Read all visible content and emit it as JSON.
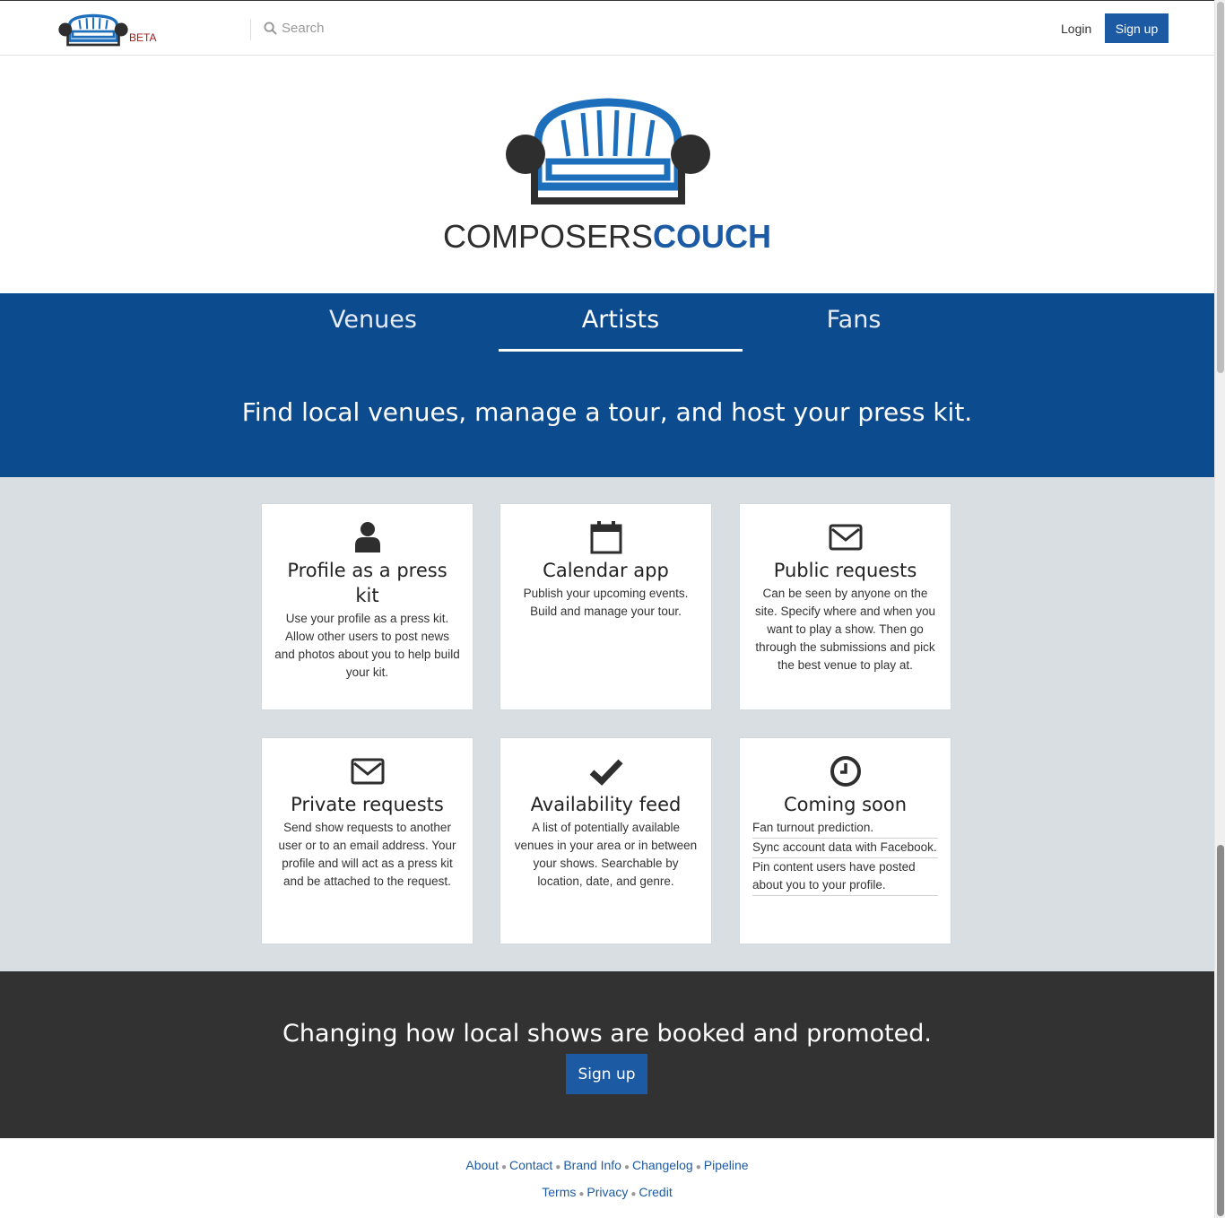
{
  "header": {
    "beta_label": "BETA",
    "search_placeholder": "Search",
    "login_label": "Login",
    "signup_label": "Sign up"
  },
  "brand": {
    "light": "COMPOSERS",
    "bold": "COUCH"
  },
  "tabs": [
    {
      "label": "Venues"
    },
    {
      "label": "Artists",
      "active": true
    },
    {
      "label": "Fans"
    }
  ],
  "tagline": "Find local venues, manage a tour, and host your press kit.",
  "features": [
    {
      "icon": "user-icon",
      "title": "Profile as a press kit",
      "text": "Use your profile as a press kit. Allow other users to post news and photos about you to help build your kit."
    },
    {
      "icon": "calendar-icon",
      "title": "Calendar app",
      "text": "Publish your upcoming events. Build and manage your tour."
    },
    {
      "icon": "envelope-icon",
      "title": "Public requests",
      "text": "Can be seen by anyone on the site. Specify where and when you want to play a show. Then go through the submissions and pick the best venue to play at."
    },
    {
      "icon": "envelope-icon",
      "title": "Private requests",
      "text": "Send show requests to another user or to an email address. Your profile and will act as a press kit and be attached to the request."
    },
    {
      "icon": "checkmark-icon",
      "title": "Availability feed",
      "text": "A list of potentially available venues in your area or in between your shows. Searchable by location, date, and genre."
    },
    {
      "icon": "clock-icon",
      "title": "Coming soon",
      "items": [
        "Fan turnout prediction.",
        "Sync account data with Facebook.",
        "Pin content users have posted about you to your profile."
      ]
    }
  ],
  "cta": {
    "heading": "Changing how local shows are booked and promoted.",
    "button_label": "Sign up"
  },
  "footer": {
    "row1": [
      "About",
      "Contact",
      "Brand Info",
      "Changelog",
      "Pipeline"
    ],
    "row2": [
      "Terms",
      "Privacy",
      "Credit"
    ]
  },
  "colors": {
    "brand_blue": "#1d5aa4",
    "band_blue": "#0c4b8e",
    "dark": "#323232",
    "feature_bg": "#d9dee2"
  }
}
